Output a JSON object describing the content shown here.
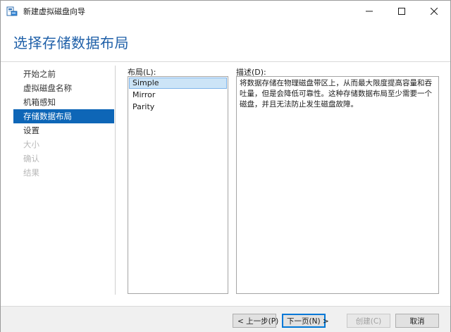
{
  "window": {
    "title": "新建虚拟磁盘向导",
    "icon": "disk-wizard-icon"
  },
  "header": {
    "title": "选择存储数据布局"
  },
  "nav": {
    "items": [
      {
        "label": "开始之前",
        "state": "normal"
      },
      {
        "label": "虚拟磁盘名称",
        "state": "normal"
      },
      {
        "label": "机箱感知",
        "state": "normal"
      },
      {
        "label": "存储数据布局",
        "state": "active"
      },
      {
        "label": "设置",
        "state": "normal"
      },
      {
        "label": "大小",
        "state": "disabled"
      },
      {
        "label": "确认",
        "state": "disabled"
      },
      {
        "label": "结果",
        "state": "disabled"
      }
    ]
  },
  "layout": {
    "label": "布局(L):",
    "options": [
      "Simple",
      "Mirror",
      "Parity"
    ],
    "selected": "Simple"
  },
  "description": {
    "label": "描述(D):",
    "text": "将数据存储在物理磁盘带区上，从而最大限度提高容量和吞吐量，但是会降低可靠性。这种存储数据布局至少需要一个磁盘，并且无法防止发生磁盘故障。"
  },
  "buttons": {
    "prev": "< 上一步(P)",
    "next": "下一页(N) >",
    "create": "创建(C)",
    "cancel": "取消"
  },
  "colors": {
    "accent": "#0e66b7",
    "title": "#1e5fa8",
    "selection": "#cce4f7"
  }
}
